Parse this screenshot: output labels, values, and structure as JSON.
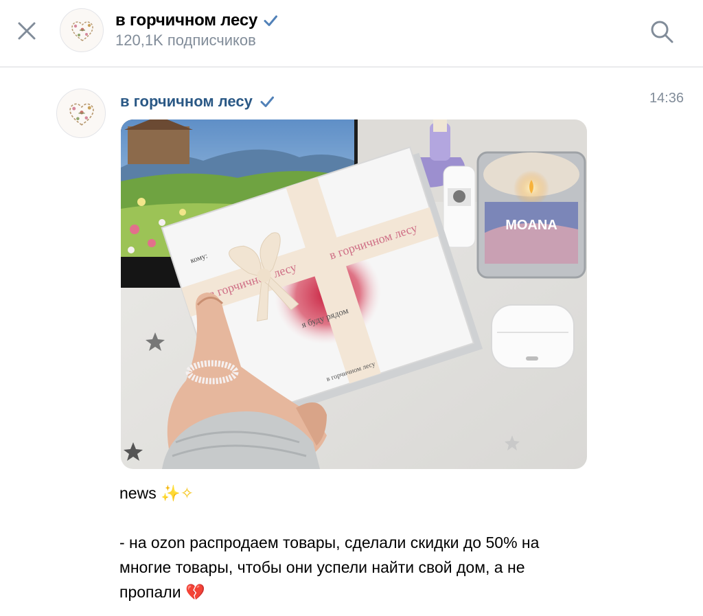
{
  "header": {
    "title": "в горчичном лесу",
    "subscribers": "120,1K подписчиков",
    "icons": {
      "close": "close-icon",
      "search": "search-icon",
      "verified": "verified-checkmark-icon"
    }
  },
  "post": {
    "author": "в горчичном лесу",
    "time": "14:36",
    "photo": {
      "box_ribbon_text": "в горчичном лесу",
      "card_text": "я буду рядом",
      "card_label": "кому:",
      "card_footer": "в горчичном лесу",
      "candle_label": "MOANA"
    },
    "text": {
      "line1": "news",
      "line1_emojis": "✨✧",
      "line2": "- на ozon распродаем товары, сделали скидки до 50%  на",
      "line3": "многие товары, чтобы они успели найти свой дом, а не",
      "line4": "пропали",
      "line4_emoji": "💔"
    }
  },
  "colors": {
    "link": "#2a5885",
    "secondary": "#818c99",
    "verified": "#5181b8",
    "divider": "#d7d8db"
  }
}
